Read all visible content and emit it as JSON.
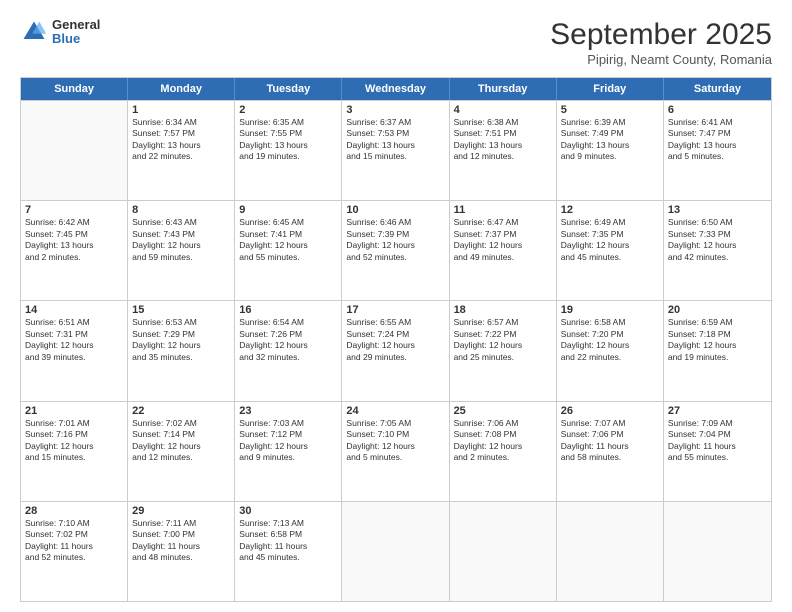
{
  "logo": {
    "general": "General",
    "blue": "Blue"
  },
  "header": {
    "month": "September 2025",
    "location": "Pipirig, Neamt County, Romania"
  },
  "days_of_week": [
    "Sunday",
    "Monday",
    "Tuesday",
    "Wednesday",
    "Thursday",
    "Friday",
    "Saturday"
  ],
  "weeks": [
    [
      {
        "num": "",
        "info": ""
      },
      {
        "num": "1",
        "info": "Sunrise: 6:34 AM\nSunset: 7:57 PM\nDaylight: 13 hours\nand 22 minutes."
      },
      {
        "num": "2",
        "info": "Sunrise: 6:35 AM\nSunset: 7:55 PM\nDaylight: 13 hours\nand 19 minutes."
      },
      {
        "num": "3",
        "info": "Sunrise: 6:37 AM\nSunset: 7:53 PM\nDaylight: 13 hours\nand 15 minutes."
      },
      {
        "num": "4",
        "info": "Sunrise: 6:38 AM\nSunset: 7:51 PM\nDaylight: 13 hours\nand 12 minutes."
      },
      {
        "num": "5",
        "info": "Sunrise: 6:39 AM\nSunset: 7:49 PM\nDaylight: 13 hours\nand 9 minutes."
      },
      {
        "num": "6",
        "info": "Sunrise: 6:41 AM\nSunset: 7:47 PM\nDaylight: 13 hours\nand 5 minutes."
      }
    ],
    [
      {
        "num": "7",
        "info": "Sunrise: 6:42 AM\nSunset: 7:45 PM\nDaylight: 13 hours\nand 2 minutes."
      },
      {
        "num": "8",
        "info": "Sunrise: 6:43 AM\nSunset: 7:43 PM\nDaylight: 12 hours\nand 59 minutes."
      },
      {
        "num": "9",
        "info": "Sunrise: 6:45 AM\nSunset: 7:41 PM\nDaylight: 12 hours\nand 55 minutes."
      },
      {
        "num": "10",
        "info": "Sunrise: 6:46 AM\nSunset: 7:39 PM\nDaylight: 12 hours\nand 52 minutes."
      },
      {
        "num": "11",
        "info": "Sunrise: 6:47 AM\nSunset: 7:37 PM\nDaylight: 12 hours\nand 49 minutes."
      },
      {
        "num": "12",
        "info": "Sunrise: 6:49 AM\nSunset: 7:35 PM\nDaylight: 12 hours\nand 45 minutes."
      },
      {
        "num": "13",
        "info": "Sunrise: 6:50 AM\nSunset: 7:33 PM\nDaylight: 12 hours\nand 42 minutes."
      }
    ],
    [
      {
        "num": "14",
        "info": "Sunrise: 6:51 AM\nSunset: 7:31 PM\nDaylight: 12 hours\nand 39 minutes."
      },
      {
        "num": "15",
        "info": "Sunrise: 6:53 AM\nSunset: 7:29 PM\nDaylight: 12 hours\nand 35 minutes."
      },
      {
        "num": "16",
        "info": "Sunrise: 6:54 AM\nSunset: 7:26 PM\nDaylight: 12 hours\nand 32 minutes."
      },
      {
        "num": "17",
        "info": "Sunrise: 6:55 AM\nSunset: 7:24 PM\nDaylight: 12 hours\nand 29 minutes."
      },
      {
        "num": "18",
        "info": "Sunrise: 6:57 AM\nSunset: 7:22 PM\nDaylight: 12 hours\nand 25 minutes."
      },
      {
        "num": "19",
        "info": "Sunrise: 6:58 AM\nSunset: 7:20 PM\nDaylight: 12 hours\nand 22 minutes."
      },
      {
        "num": "20",
        "info": "Sunrise: 6:59 AM\nSunset: 7:18 PM\nDaylight: 12 hours\nand 19 minutes."
      }
    ],
    [
      {
        "num": "21",
        "info": "Sunrise: 7:01 AM\nSunset: 7:16 PM\nDaylight: 12 hours\nand 15 minutes."
      },
      {
        "num": "22",
        "info": "Sunrise: 7:02 AM\nSunset: 7:14 PM\nDaylight: 12 hours\nand 12 minutes."
      },
      {
        "num": "23",
        "info": "Sunrise: 7:03 AM\nSunset: 7:12 PM\nDaylight: 12 hours\nand 9 minutes."
      },
      {
        "num": "24",
        "info": "Sunrise: 7:05 AM\nSunset: 7:10 PM\nDaylight: 12 hours\nand 5 minutes."
      },
      {
        "num": "25",
        "info": "Sunrise: 7:06 AM\nSunset: 7:08 PM\nDaylight: 12 hours\nand 2 minutes."
      },
      {
        "num": "26",
        "info": "Sunrise: 7:07 AM\nSunset: 7:06 PM\nDaylight: 11 hours\nand 58 minutes."
      },
      {
        "num": "27",
        "info": "Sunrise: 7:09 AM\nSunset: 7:04 PM\nDaylight: 11 hours\nand 55 minutes."
      }
    ],
    [
      {
        "num": "28",
        "info": "Sunrise: 7:10 AM\nSunset: 7:02 PM\nDaylight: 11 hours\nand 52 minutes."
      },
      {
        "num": "29",
        "info": "Sunrise: 7:11 AM\nSunset: 7:00 PM\nDaylight: 11 hours\nand 48 minutes."
      },
      {
        "num": "30",
        "info": "Sunrise: 7:13 AM\nSunset: 6:58 PM\nDaylight: 11 hours\nand 45 minutes."
      },
      {
        "num": "",
        "info": ""
      },
      {
        "num": "",
        "info": ""
      },
      {
        "num": "",
        "info": ""
      },
      {
        "num": "",
        "info": ""
      }
    ]
  ]
}
